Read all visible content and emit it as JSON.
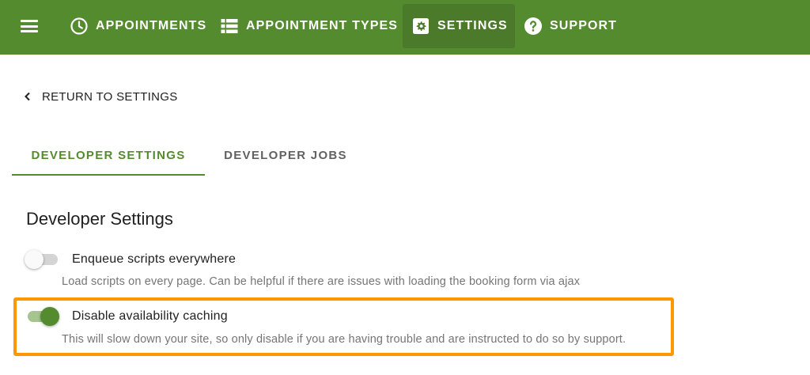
{
  "nav": {
    "items": [
      {
        "label": "APPOINTMENTS",
        "icon": "clock-icon"
      },
      {
        "label": "APPOINTMENT TYPES",
        "icon": "list-icon"
      },
      {
        "label": "SETTINGS",
        "icon": "gear-icon",
        "active": true
      },
      {
        "label": "SUPPORT",
        "icon": "help-circle-icon"
      }
    ]
  },
  "back": {
    "label": "RETURN TO SETTINGS"
  },
  "tabs": [
    {
      "label": "DEVELOPER SETTINGS",
      "active": true
    },
    {
      "label": "DEVELOPER JOBS",
      "active": false
    }
  ],
  "section": {
    "title": "Developer Settings"
  },
  "options": [
    {
      "label": "Enqueue scripts everywhere",
      "hint": "Load scripts on every page. Can be helpful if there are issues with loading the booking form via ajax",
      "enabled": false
    },
    {
      "label": "Disable availability caching",
      "hint": "This will slow down your site, so only disable if you are having trouble and are instructed to do so by support.",
      "enabled": true
    }
  ],
  "colors": {
    "brand": "#558b2f",
    "highlight": "#ff9800"
  }
}
